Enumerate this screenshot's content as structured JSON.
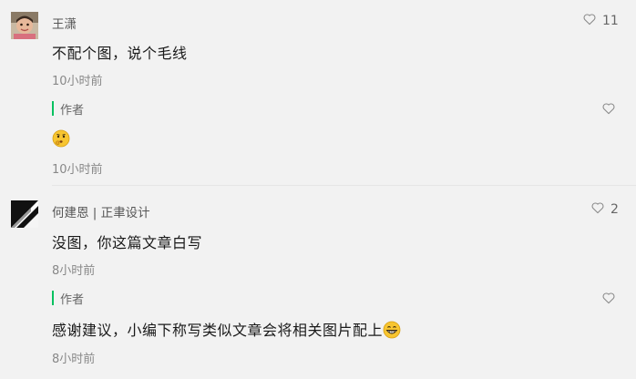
{
  "comments": [
    {
      "user": "王潇",
      "text": "不配个图，说个毛线",
      "time": "10小时前",
      "likes": "11",
      "reply": {
        "tag": "作者",
        "emoji": "thinking-face-emoji",
        "time": "10小时前"
      }
    },
    {
      "user": "何建恩 | 正聿设计",
      "text": "没图，你这篇文章白写",
      "time": "8小时前",
      "likes": "2",
      "reply": {
        "tag": "作者",
        "text": "感谢建议，小编下称写类似文章会将相关图片配上",
        "emoji": "grinning-face-emoji",
        "time": "8小时前"
      }
    }
  ],
  "icons": {
    "like": "heart-outline-icon"
  },
  "colors": {
    "background": "#f2f2f2",
    "author_accent": "#07c160",
    "muted_text": "#888888"
  }
}
